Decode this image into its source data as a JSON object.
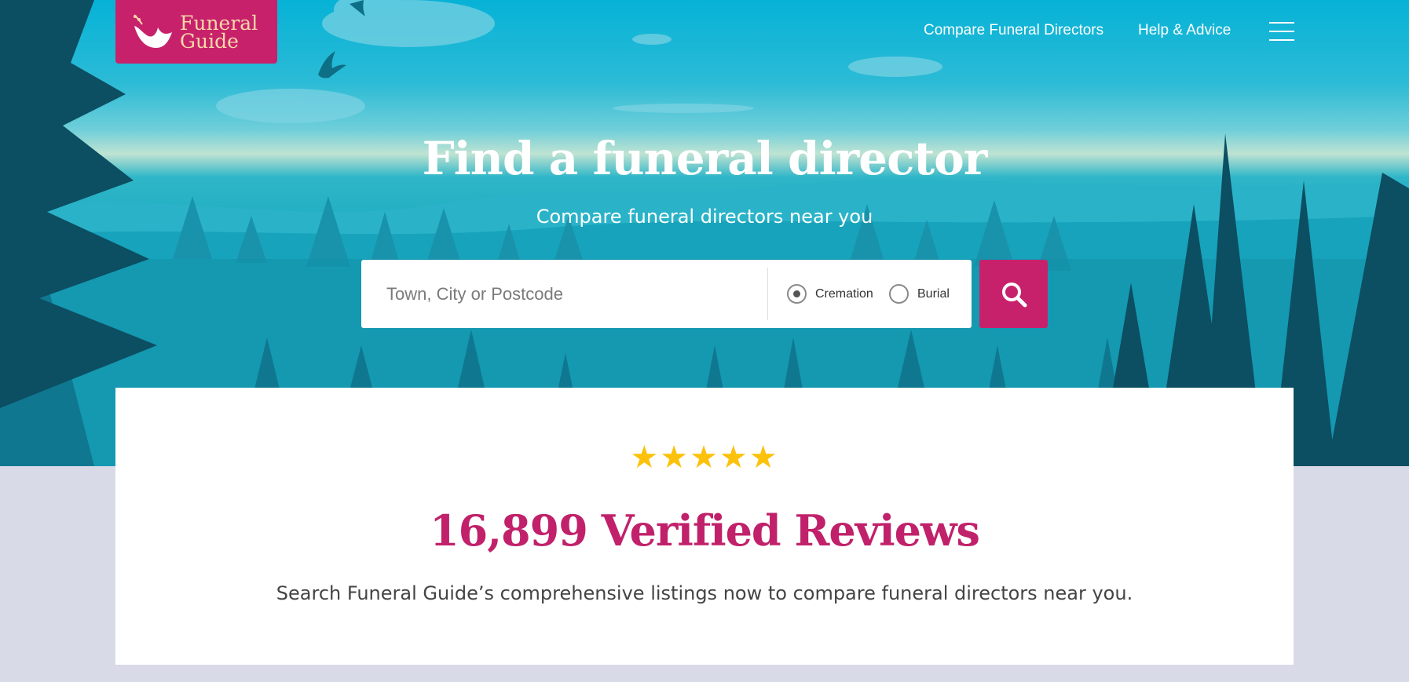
{
  "brand": {
    "logo_line1": "Funeral",
    "logo_line2": "Guide",
    "primary_color": "#c8216c",
    "logo_text_color": "#f7d9a8"
  },
  "nav": {
    "links": [
      {
        "label": "Compare Funeral Directors"
      },
      {
        "label": "Help & Advice"
      }
    ],
    "menu_icon": "hamburger-icon"
  },
  "hero": {
    "title": "Find a funeral director",
    "subtitle": "Compare funeral directors near you"
  },
  "search": {
    "placeholder": "Town, City or Postcode",
    "value": "",
    "options": [
      {
        "label": "Cremation",
        "selected": true
      },
      {
        "label": "Burial",
        "selected": false
      }
    ],
    "button_icon": "search-icon"
  },
  "reviews": {
    "stars": "★★★★★",
    "rating": 5,
    "title": "16,899 Verified Reviews",
    "text": "Search Funeral Guide’s comprehensive listings now to compare funeral directors near you.",
    "star_color": "#fcc10a"
  }
}
